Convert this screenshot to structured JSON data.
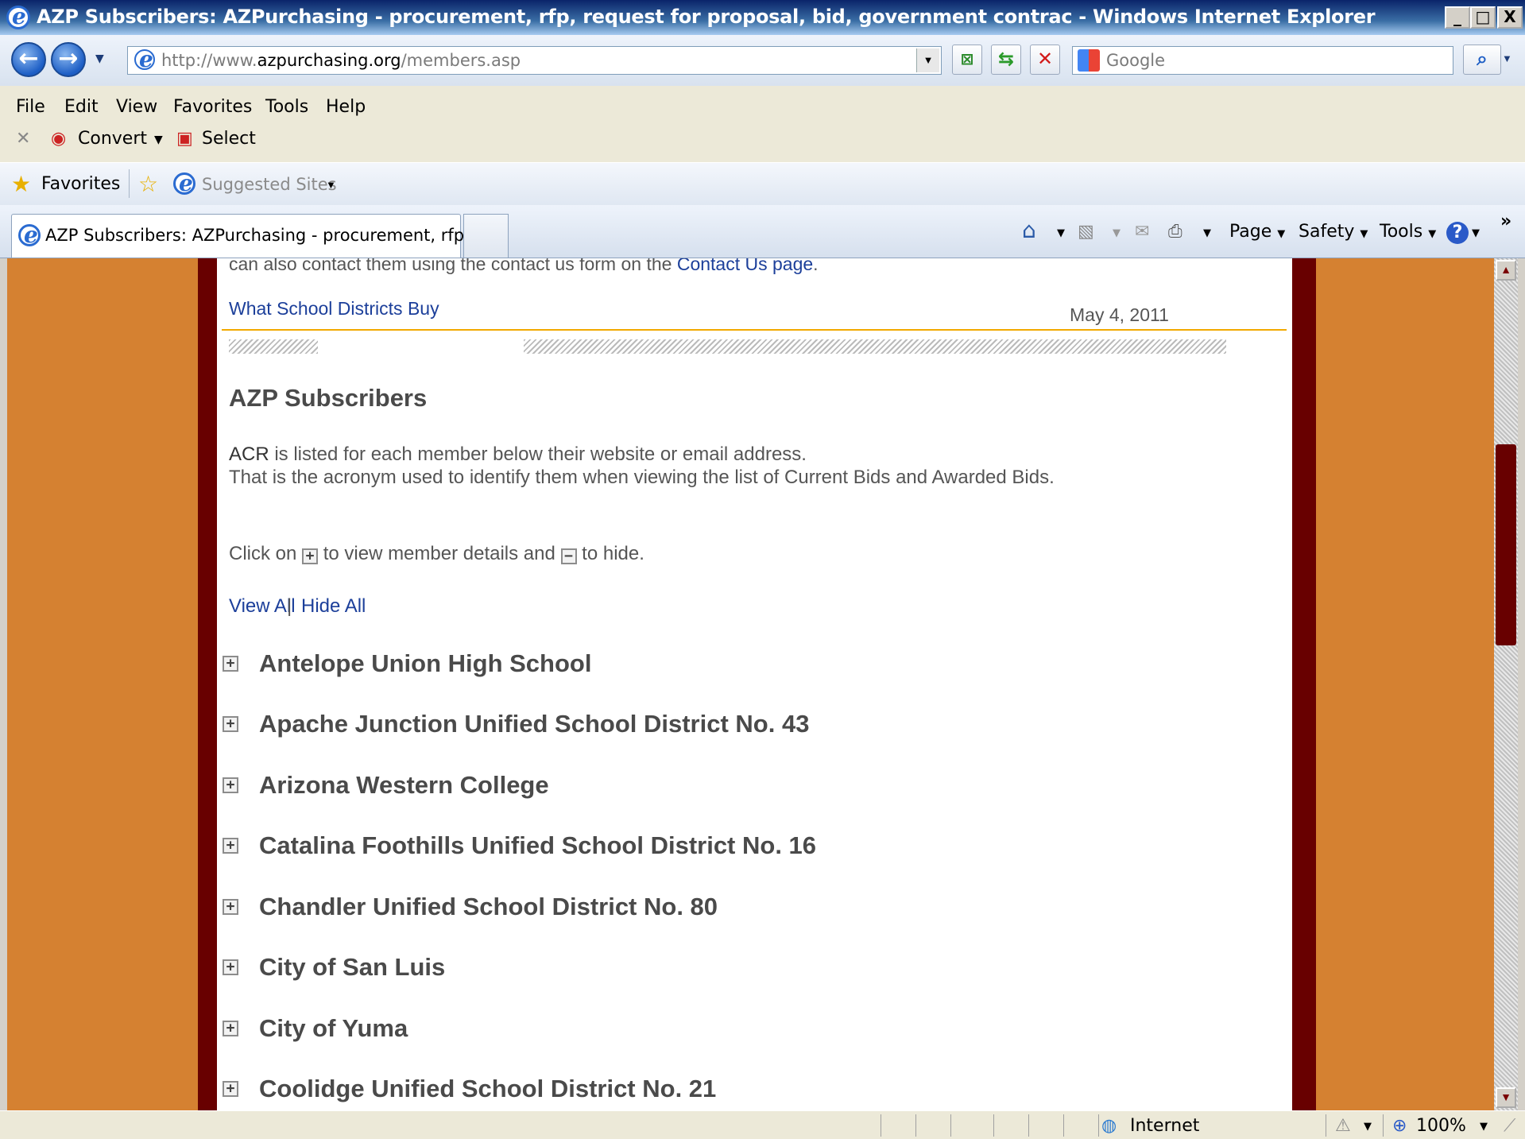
{
  "window": {
    "title": "AZP Subscribers: AZPurchasing - procurement, rfp, request for proposal, bid, government contrac - Windows Internet Explorer",
    "min_label": "_",
    "max_label": "□",
    "close_label": "X"
  },
  "address": {
    "url_prefix": "http://www.",
    "url_domain": "azpurchasing.org",
    "url_path": "/members.asp",
    "search_placeholder": "Google"
  },
  "menu": [
    "File",
    "Edit",
    "View",
    "Favorites",
    "Tools",
    "Help"
  ],
  "toolbar": {
    "convert_label": "Convert",
    "select_label": "Select"
  },
  "favorites": {
    "favorites_label": "Favorites",
    "suggested_label": "Suggested Sites"
  },
  "tab": {
    "title": "AZP Subscribers: AZPurchasing - procurement, rfp, re..."
  },
  "commands": {
    "page": "Page",
    "safety": "Safety",
    "tools": "Tools"
  },
  "content": {
    "top_partial_text": "can also contact them using the contact us form on the ",
    "contact_link": "Contact Us page",
    "top_period": ".",
    "what_buy_link": "What School Districts Buy",
    "date": "May 4, 2011",
    "heading": "AZP Subscribers",
    "acr_label": "ACR",
    "acr_line": " is listed for each member below their website or email address.",
    "acronym_line": "That is the acronym used to identify them when viewing the list of Current Bids and Awarded Bids.",
    "click_on": "Click on ",
    "to_view": " to view member details and ",
    "to_hide": " to hide.",
    "view_all": "View All",
    "sep": "|",
    "hide_all": "Hide All",
    "plus_symbol": "+",
    "minus_symbol": "−"
  },
  "members": [
    "Antelope Union High School",
    "Apache Junction Unified School District No. 43",
    "Arizona Western College",
    "Catalina Foothills Unified School District No. 16",
    "Chandler Unified School District No. 80",
    "City of San Luis",
    "City of Yuma",
    "Coolidge Unified School District No. 21"
  ],
  "status": {
    "zone": "Internet",
    "zoom": "100%"
  },
  "colors": {
    "page_bg": "#d58131",
    "frame": "#680000",
    "link": "#1c3f9a",
    "rule": "#f2a900"
  }
}
